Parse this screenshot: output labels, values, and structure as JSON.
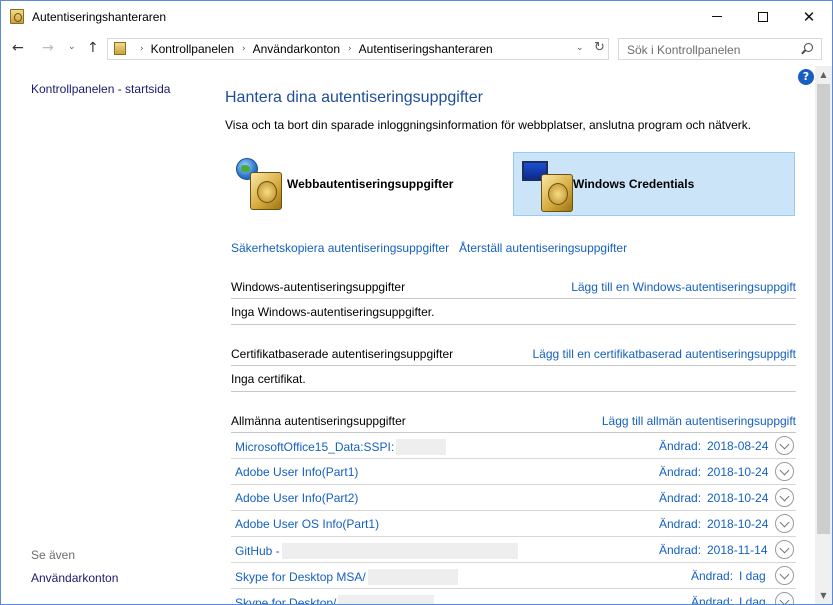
{
  "window": {
    "title": "Autentiseringshanteraren",
    "minimize_label": "",
    "close_label": "✕"
  },
  "nav": {
    "back_icon": "←",
    "forward_icon": "→",
    "recent_icon": "⌄",
    "up_icon": "↑",
    "breadcrumb": [
      "Kontrollpanelen",
      "Användarkonton",
      "Autentiseringshanteraren"
    ],
    "breadcrumb_sep": "›",
    "dropdown_icon": "⌄",
    "refresh_icon": "↻",
    "search_placeholder": "Sök i Kontrollpanelen"
  },
  "help": {
    "label": "?"
  },
  "left": {
    "home_link": "Kontrollpanelen - startsida",
    "see_also": "Se även",
    "accounts_link": "Användarkonton"
  },
  "main": {
    "heading": "Hantera dina autentiseringsuppgifter",
    "subtext": "Visa och ta bort din sparade inloggningsinformation för webbplatser, anslutna program och nätverk.",
    "tiles": {
      "web": "Webbautentiseringsuppgifter",
      "windows": "Windows Credentials"
    },
    "backup_link": "Säkerhetskopiera autentiseringsuppgifter",
    "restore_link": "Återställ autentiseringsuppgifter",
    "windows_section": {
      "title": "Windows-autentiseringsuppgifter",
      "add_link": "Lägg till en Windows-autentiseringsuppgift",
      "empty": "Inga Windows-autentiseringsuppgifter."
    },
    "cert_section": {
      "title": "Certifikatbaserade autentiseringsuppgifter",
      "add_link": "Lägg till en certifikatbaserad autentiseringsuppgift",
      "empty": "Inga certifikat."
    },
    "generic_section": {
      "title": "Allmänna autentiseringsuppgifter",
      "add_link": "Lägg till allmän autentiseringsuppgift",
      "items": [
        {
          "name": "MicrosoftOffice15_Data:SSPI:",
          "label": "Ändrad:",
          "date": "2018-08-24"
        },
        {
          "name": "Adobe User Info(Part1)",
          "label": "Ändrad:",
          "date": "2018-10-24"
        },
        {
          "name": "Adobe User Info(Part2)",
          "label": "Ändrad:",
          "date": "2018-10-24"
        },
        {
          "name": "Adobe User OS Info(Part1)",
          "label": "Ändrad:",
          "date": "2018-10-24"
        },
        {
          "name": "GitHub - ",
          "label": "Ändrad:",
          "date": "2018-11-14"
        },
        {
          "name": "Skype for Desktop MSA/",
          "label": "Ändrad:",
          "date": "I dag"
        },
        {
          "name": "Skype for Desktop/",
          "label": "Ändrad:",
          "date": "I dag"
        }
      ]
    }
  },
  "scrollbar": {
    "up_icon": "▲",
    "down_icon": "▼"
  },
  "colors": {
    "link": "#1560c0",
    "heading": "#1e4e99",
    "selected_tile": "#cce4f7"
  }
}
